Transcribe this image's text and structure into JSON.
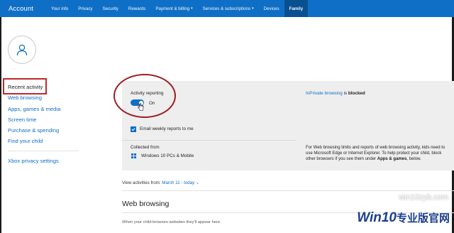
{
  "header": {
    "brand": "Account",
    "nav": [
      {
        "label": "Your info"
      },
      {
        "label": "Privacy"
      },
      {
        "label": "Security"
      },
      {
        "label": "Rewards"
      },
      {
        "label": "Payment & billing"
      },
      {
        "label": "Services & subscriptions"
      },
      {
        "label": "Devices"
      },
      {
        "label": "Family"
      }
    ],
    "active_nav": "Family",
    "bg_color": "#0f6fc6"
  },
  "sidebar": {
    "items": [
      {
        "label": "Recent activity"
      },
      {
        "label": "Web browsing"
      },
      {
        "label": "Apps, games & media"
      },
      {
        "label": "Screen time"
      },
      {
        "label": "Purchase & spending"
      },
      {
        "label": "Find your child"
      }
    ],
    "bottom_link": "Xbox privacy settings"
  },
  "activity": {
    "reporting_label": "Activity reporting",
    "toggle_state": "On",
    "email_label": "Email weekly reports to me",
    "collected_label": "Collected from",
    "devices": "Windows 10 PCs & Mobile",
    "inprivate_link": "InPrivate browsing",
    "inprivate_is": "is",
    "inprivate_status": "blocked",
    "help_text_1": "For Web browsing limits and reports of web browsing activity, kids need to use Microsoft Edge or Internet Explorer. To help protect your child, block other browsers if you see them under",
    "help_bold": "Apps & games",
    "help_text_2": ", below."
  },
  "view_activities": {
    "label": "View activities from:",
    "value": "March 11 - today"
  },
  "web_browsing": {
    "heading": "Web browsing",
    "description": "When your child browses websites they'll appear here."
  },
  "watermark": {
    "text_top": "win10zyb.com",
    "brand": "Win10",
    "brand_cn": "专业版官网"
  },
  "colors": {
    "accent": "#0f6fc6",
    "highlight_red": "#c0272d"
  }
}
